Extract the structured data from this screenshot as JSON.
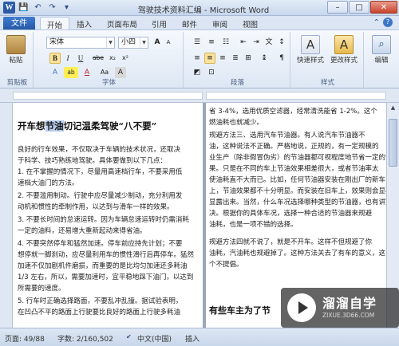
{
  "window": {
    "title": "驾驶技术资料汇编 - Microsoft Word"
  },
  "qat": {
    "word": "W",
    "save": "💾",
    "undo": "↶",
    "redo": "↷",
    "customize": "▾"
  },
  "tabs": {
    "file": "文件",
    "items": [
      "开始",
      "插入",
      "页面布局",
      "引用",
      "邮件",
      "审阅",
      "视图"
    ]
  },
  "ribbon": {
    "clipboard": {
      "label": "剪贴板",
      "paste": "粘贴"
    },
    "font": {
      "label": "字体",
      "name": "宋体",
      "size": "小四",
      "row2": [
        "B",
        "I",
        "U",
        "abe",
        "x₂",
        "x²"
      ],
      "row3": [
        "A",
        "ab",
        "A",
        "Aa",
        "A"
      ]
    },
    "paragraph": {
      "label": "段落"
    },
    "styles": {
      "label": "样式",
      "quick": "快速样式",
      "change": "更改样式"
    },
    "editing": {
      "label": "编辑",
      "edit": "编辑"
    }
  },
  "doc": {
    "title_pre": "开车想",
    "title_hl": "节油",
    "title_post": "切记温柔驾驶“八不要”",
    "left_lines": [
      "    良好的行车效果，不仅取决于车辆的技术状况，还取决",
      "于科学、技巧熟练地驾驶。具体要做到以下几点：",
      "    1. 在不掌握的情况下，尽量用高速档行车，不要采用低",
      "速档大油门的方法。",
      "    2. 不要滥用制动。行驶中应尽量减少制动，充分利用发",
      "动机和惯性的牵制作用，以达到与滑车一样的效果。",
      "    3. 不要长时间的怠速运转。因为车辆怠速运转时仍需消耗",
      "一定的油料，还易增大重新起动来得省油。",
      "    4. 不要突然停车和猛然加速。停车前应持先计划；不要",
      "想停就一脚刹动，应尽量利用车的惯性滑行后再停车。猛然",
      "加速不仅加剧机件磨损，而重要的是比均匀加速还多耗油",
      "1/3 左右，所以，需要加速时，宜平稳地踩下油门，以达到",
      "所需要的速度。",
      "    5. 行车时正确选择路面，不要乱冲乱撞。据试验表明，",
      "在凹凸不平的路面上行驶要比良好的路面上行驶多耗油"
    ],
    "right_lines": [
      "省 3-4%，选用优质空滤器，经常清洗能省 1-2%。这个",
      "燃油耗也就减少。",
      "    规避方法三、选用汽车节油器。有人说汽车节油器不",
      "油，这种说法不正确。严格地说，正规的，有一定规模的",
      "业生产（除非假冒伪劣）的节油器都可视程度地节省一定的油",
      "果。只是在不同的车上节油效果相差很大，或者节油率太",
      "使油耗直不大而已。比如，任何节油器安装在刚出厂的新车",
      "上，节油效果都不十分明显。而安装在旧车上，效果则会显著",
      "显露出来。当然，什么车况选择哪种类型的节油器，也有讲究",
      "决。根据你的具体车况，选择一种合适的节油器来规避",
      "油耗，也是一项不错的选择。",
      "    规避方法四就不说了，就是不开车。这样不但规避了你",
      "油耗，汽油耗也规避掉了。这种方法关去了有车的意义，这",
      "个不提倡。"
    ],
    "right_heading": "有些车主为了节"
  },
  "status": {
    "page": "页面: 49/88",
    "words": "字数: 2/160,502",
    "lang": "中文(中国)",
    "mode": "插入"
  },
  "watermark": {
    "title": "溜溜自学",
    "sub": "ZIXUE.3D66.COM"
  }
}
